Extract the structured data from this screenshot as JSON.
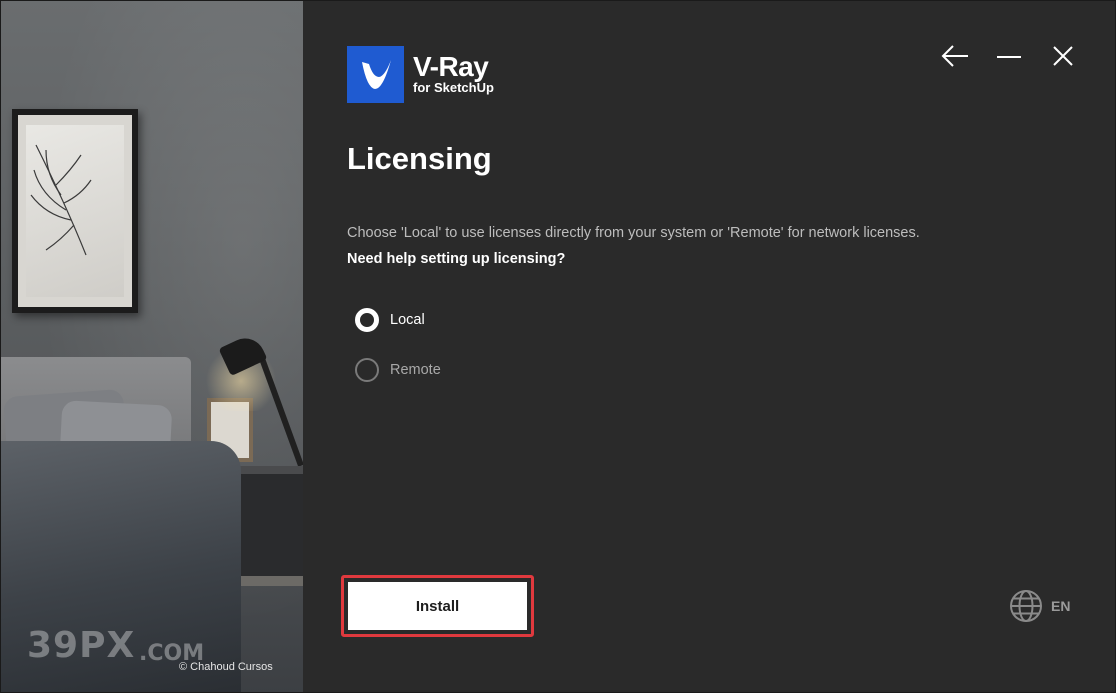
{
  "app": {
    "logo_title": "V-Ray",
    "logo_subtitle": "for SketchUp",
    "accent_color": "#1f5bd1"
  },
  "window_controls": {
    "back_icon": "arrow-left-icon",
    "minimize_icon": "minimize-icon",
    "close_icon": "close-icon"
  },
  "photo_panel": {
    "credit": "© Chahoud Cursos",
    "watermark_main": "39PX",
    "watermark_suffix": ".COM"
  },
  "page": {
    "title": "Licensing",
    "description": "Choose 'Local' to use licenses directly from your system or 'Remote' for network licenses.",
    "help_link": "Need help setting up licensing?"
  },
  "license_options": [
    {
      "label": "Local",
      "selected": true
    },
    {
      "label": "Remote",
      "selected": false
    }
  ],
  "footer": {
    "install_label": "Install",
    "highlight_color": "#e0393e",
    "language_icon": "globe-icon",
    "language_code": "EN"
  }
}
